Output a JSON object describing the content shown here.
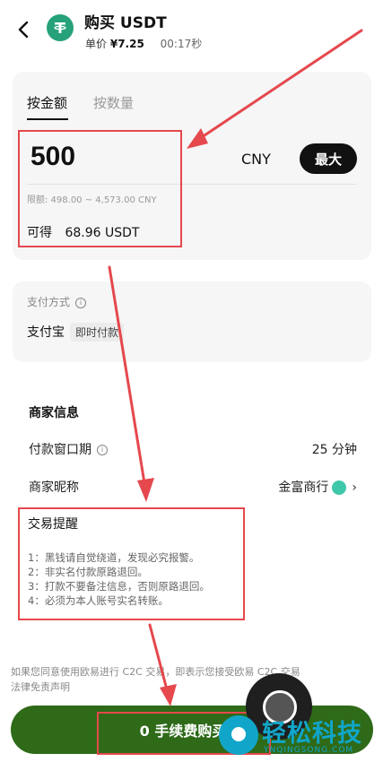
{
  "header": {
    "title": "购买 USDT",
    "price_label": "单价",
    "price_value": "¥7.25",
    "timer": "00:17秒"
  },
  "order": {
    "tab_amount": "按金额",
    "tab_quantity": "按数量",
    "amount_value": "500",
    "currency": "CNY",
    "max_label": "最大",
    "limit_text": "限额: 498.00 ~ 4,573.00 CNY",
    "receive_label": "可得",
    "receive_value": "68.96 USDT"
  },
  "payment": {
    "label": "支付方式",
    "method": "支付宝",
    "tag": "即时付款"
  },
  "merchant": {
    "title": "商家信息",
    "window_label": "付款窗口期",
    "window_value": "25 分钟",
    "nickname_label": "商家昵称",
    "nickname_value": "金富商行"
  },
  "notice": {
    "title": "交易提醒",
    "items": [
      "1：黑钱请自觉绕道，发现必究报警。",
      "2：非实名付款原路退回。",
      "3：打款不要备注信息，否则原路退回。",
      "4：必须为本人账号实名转账。"
    ]
  },
  "disclaimer": {
    "line1": "如果您同意使用欧易进行 C2C 交易，即表示您接受欧易 C2C 交易",
    "line2": "法律免责声明"
  },
  "buy_button": {
    "label": "0 手续费购买"
  },
  "watermark": {
    "text": "轻松科技",
    "sub": "YNQINGSONG.COM"
  },
  "colors": {
    "brand_green": "#2e6a18",
    "tether_green": "#26a17b",
    "annotation_red": "#e5484d",
    "watermark_blue": "#11a6c9"
  }
}
